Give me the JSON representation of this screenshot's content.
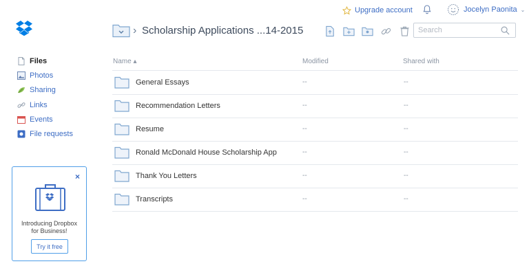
{
  "topbar": {
    "upgrade_label": "Upgrade account",
    "user_name": "Jocelyn Paonita",
    "caret": "⌄"
  },
  "sidebar": {
    "items": [
      {
        "label": "Files",
        "icon": "file-icon",
        "active": true
      },
      {
        "label": "Photos",
        "icon": "photo-icon"
      },
      {
        "label": "Sharing",
        "icon": "sharing-icon"
      },
      {
        "label": "Links",
        "icon": "link-icon"
      },
      {
        "label": "Events",
        "icon": "calendar-icon"
      },
      {
        "label": "File requests",
        "icon": "file-request-icon"
      }
    ]
  },
  "promo": {
    "close": "×",
    "text_line1": "Introducing Dropbox",
    "text_line2": "for Business!",
    "button_label": "Try it free"
  },
  "header": {
    "separator": "›",
    "title": "Scholarship Applications ...14-2015"
  },
  "search": {
    "placeholder": "Search"
  },
  "table": {
    "columns": {
      "name": "Name ▴",
      "modified": "Modified",
      "shared": "Shared with"
    },
    "rows": [
      {
        "name": "General Essays",
        "modified": "--",
        "shared": "--"
      },
      {
        "name": "Recommendation Letters",
        "modified": "--",
        "shared": "--"
      },
      {
        "name": "Resume",
        "modified": "--",
        "shared": "--"
      },
      {
        "name": "Ronald McDonald House Scholarship App",
        "modified": "--",
        "shared": "--"
      },
      {
        "name": "Thank You Letters",
        "modified": "--",
        "shared": "--"
      },
      {
        "name": "Transcripts",
        "modified": "--",
        "shared": "--"
      }
    ]
  },
  "colors": {
    "accent": "#3d6dc4",
    "brand": "#007ee5",
    "folder": "#7fa6cf",
    "divider": "#e4e8ed"
  }
}
